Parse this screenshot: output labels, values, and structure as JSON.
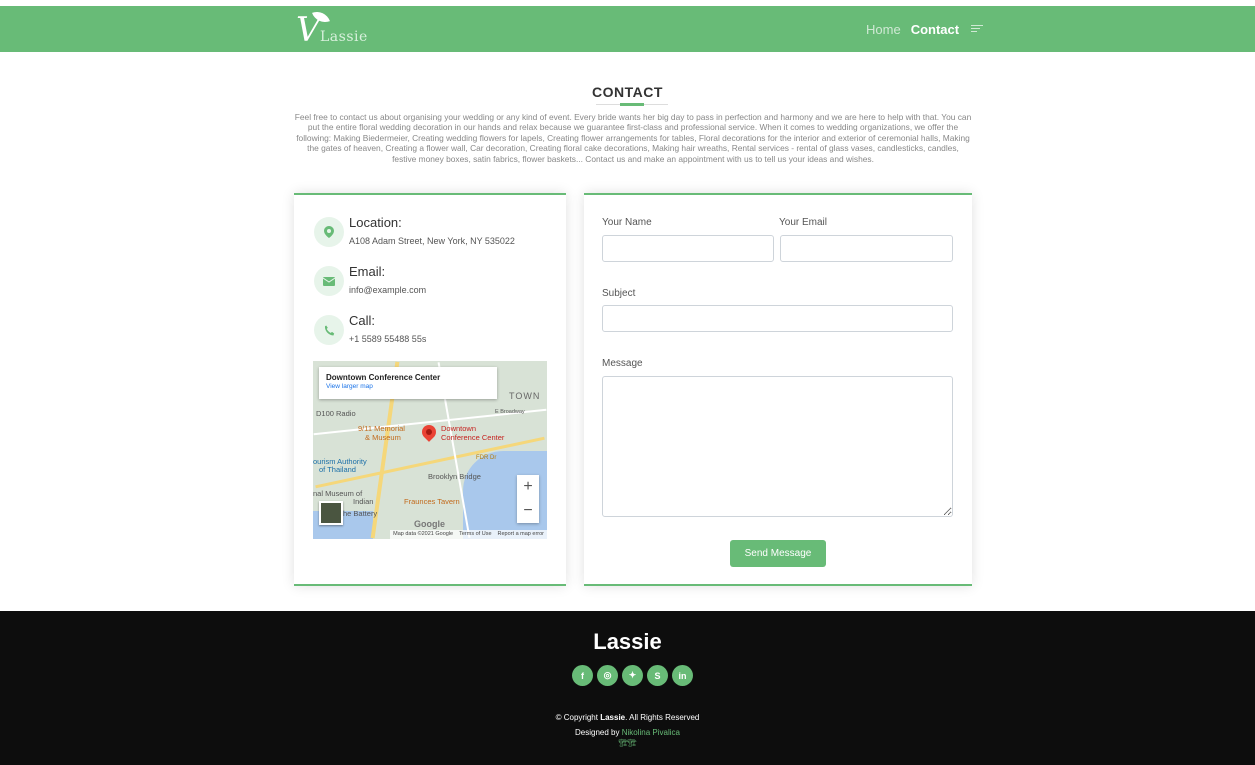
{
  "header": {
    "logo_text": "Lassie",
    "nav": [
      {
        "label": "Home",
        "active": false
      },
      {
        "label": "Contact",
        "active": true
      }
    ],
    "nav_toggle_icon": "menu-lines-icon"
  },
  "contact": {
    "title": "CONTACT",
    "intro": "Feel free to contact us about organising your wedding or any kind of event. Every bride wants her big day to pass in perfection and harmony and we are here to help with that. You can put the entire floral wedding decoration in our hands and relax because we guarantee first-class and professional service. When it comes to wedding organizations, we offer the following: Making Biedermeier, Creating wedding flowers for lapels, Creating flower arrangements for tables, Floral decorations for the interior and exterior of ceremonial halls, Making the gates of heaven, Creating a flower wall, Car decoration, Creating floral cake decorations, Making hair wreaths, Rental services - rental of glass vases, candlesticks, candles, festive money boxes, satin fabrics, flower baskets... Contact us and make an appointment with us to tell us your ideas and wishes."
  },
  "info": {
    "location": {
      "label": "Location:",
      "value": "A108 Adam Street, New York, NY 535022",
      "icon": "map-marker-icon"
    },
    "email": {
      "label": "Email:",
      "value": "info@example.com",
      "icon": "envelope-icon"
    },
    "call": {
      "label": "Call:",
      "value": "+1 5589 55488 55s",
      "icon": "phone-icon"
    }
  },
  "map": {
    "place_title": "Downtown Conference Center",
    "larger_map_link": "View larger map",
    "labels": {
      "town": "TOWN",
      "radio": "D100 Radio",
      "memorial": "9/11 Memorial",
      "museum": "& Museum",
      "pin": "Downtown",
      "pin2": "Conference Center",
      "tourism": "ourism Authority",
      "thailand": "of Thailand",
      "bridge": "Brooklyn Bridge",
      "nat_museum": "nal Museum of",
      "indian": "Indian",
      "tavern": "Fraunces Tavern",
      "battery": "he Battery",
      "broadway": "E Broadway",
      "fdr": "FDR Dr"
    },
    "google": "Google",
    "attribution": "Map data ©2021 Google",
    "terms": "Terms of Use",
    "report": "Report a map error",
    "zoom_in": "+",
    "zoom_out": "−"
  },
  "form": {
    "name_label": "Your Name",
    "email_label": "Your Email",
    "subject_label": "Subject",
    "message_label": "Message",
    "name_value": "",
    "email_value": "",
    "subject_value": "",
    "message_value": "",
    "send_label": "Send Message"
  },
  "footer": {
    "brand": "Lassie",
    "socials": [
      {
        "icon": "facebook-icon",
        "glyph": "f"
      },
      {
        "icon": "instagram-icon",
        "glyph": "◎"
      },
      {
        "icon": "twitter-icon",
        "glyph": "✦"
      },
      {
        "icon": "skype-icon",
        "glyph": "S"
      },
      {
        "icon": "linkedin-icon",
        "glyph": "in"
      }
    ],
    "copyright_prefix": "© Copyright ",
    "copyright_brand": "Lassie",
    "copyright_suffix": ". All Rights Reserved",
    "designed_prefix": "Designed by ",
    "designer": "Nikolina Pivalica",
    "mark": "🏗🏗"
  },
  "colors": {
    "accent": "#68bb77",
    "footer_bg": "#0d0d0d"
  }
}
